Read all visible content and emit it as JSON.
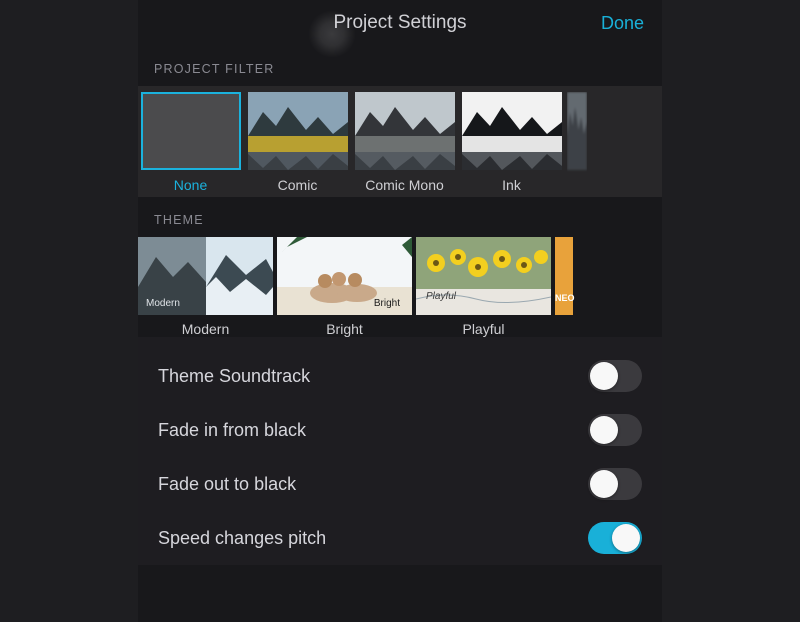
{
  "header": {
    "title": "Project Settings",
    "done_label": "Done"
  },
  "filter": {
    "section_label": "Project Filter",
    "items": [
      {
        "label": "None"
      },
      {
        "label": "Comic"
      },
      {
        "label": "Comic Mono"
      },
      {
        "label": "Ink"
      }
    ],
    "selected_index": 0
  },
  "theme": {
    "section_label": "Theme",
    "items": [
      {
        "label": "Modern",
        "overlay": "Modern"
      },
      {
        "label": "Bright",
        "overlay": "Bright"
      },
      {
        "label": "Playful",
        "overlay": "Playful"
      }
    ],
    "partial_next_overlay": "NEO"
  },
  "toggles": {
    "items": [
      {
        "label": "Theme Soundtrack",
        "value": false
      },
      {
        "label": "Fade in from black",
        "value": false
      },
      {
        "label": "Fade out to black",
        "value": false
      },
      {
        "label": "Speed changes pitch",
        "value": true
      }
    ]
  },
  "colors": {
    "accent": "#19b0d8"
  }
}
